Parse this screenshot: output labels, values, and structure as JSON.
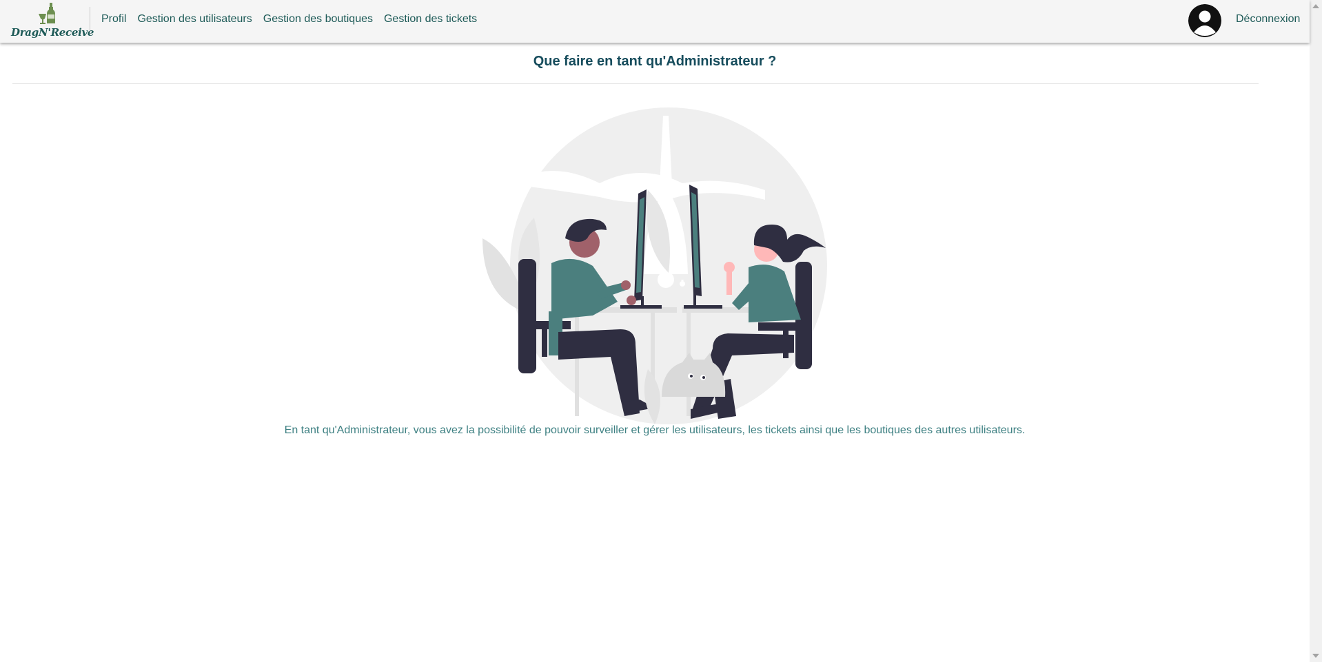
{
  "app": {
    "logo_text": "DragN'Receive",
    "logo_icon": "bottle-and-glass-icon"
  },
  "nav": {
    "items": [
      {
        "label": "Profil"
      },
      {
        "label": "Gestion des utilisateurs"
      },
      {
        "label": "Gestion des boutiques"
      },
      {
        "label": "Gestion des tickets"
      }
    ],
    "avatar_icon": "user-avatar-icon",
    "logout_label": "Déconnexion"
  },
  "main": {
    "title": "Que faire en tant qu'Administrateur ?",
    "illustration_icon": "people-working-at-computers-illustration",
    "description": "En tant qu'Administrateur, vous avez la possibilité de pouvoir surveiller et gérer les utilisateurs, les tickets ainsi que les boutiques des autres utilisateurs."
  },
  "colors": {
    "brand": "#1d5a57",
    "title": "#164c5c",
    "description": "#3f8183",
    "accent_teal": "#4b7f7e",
    "dark_navy": "#2f2e41",
    "navbar_bg": "#f5f5f5"
  }
}
